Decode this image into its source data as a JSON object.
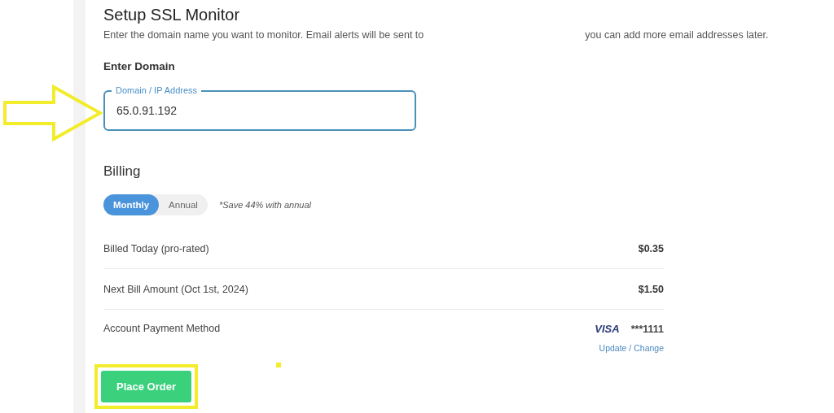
{
  "title": "Setup SSL Monitor",
  "description": {
    "before": "Enter the domain name you want to monitor. Email alerts will be sent to",
    "after": "you can add more email addresses later."
  },
  "domain_section": {
    "heading": "Enter Domain",
    "field": {
      "label": "Domain / IP Address",
      "value": "65.0.91.192",
      "focused": true
    }
  },
  "billing": {
    "heading": "Billing",
    "periods": [
      {
        "label": "Monthly",
        "selected": true
      },
      {
        "label": "Annual",
        "selected": false
      }
    ],
    "note": "*Save 44% with annual",
    "rows": [
      {
        "label": "Billed Today (pro-rated)",
        "value": "$0.35"
      },
      {
        "label": "Next Bill Amount (Oct 1st, 2024)",
        "value": "$1.50"
      }
    ],
    "payment": {
      "label": "Account Payment Method",
      "card_brand": "VISA",
      "card_number": "***1111",
      "link": "Update / Change"
    }
  },
  "button": "Place Order"
}
